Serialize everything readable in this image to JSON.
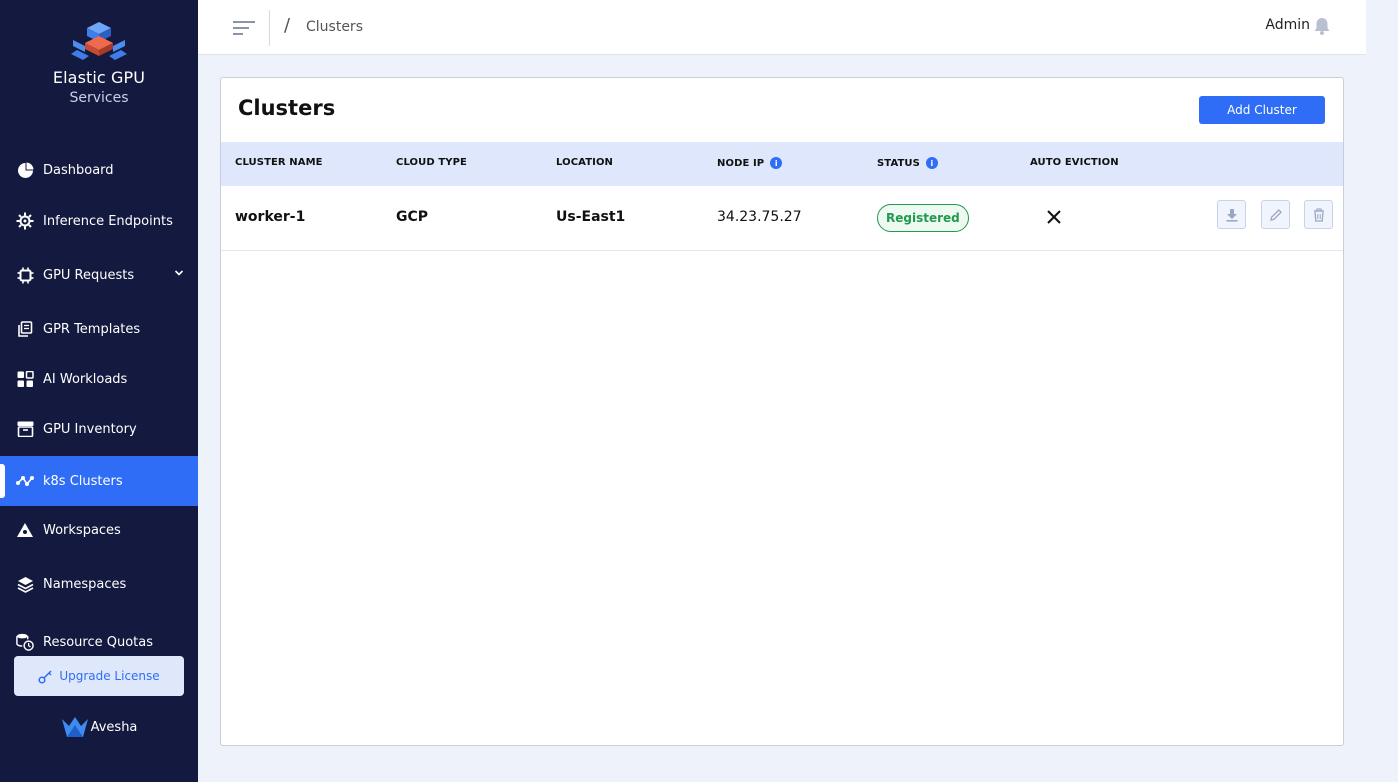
{
  "brand": {
    "title": "Elastic GPU",
    "subtitle": "Services"
  },
  "sidebar": {
    "items": [
      {
        "label": "Dashboard",
        "icon": "pie-chart-icon"
      },
      {
        "label": "Inference Endpoints",
        "icon": "gear-chip-icon"
      },
      {
        "label": "GPU Requests",
        "icon": "chip-icon",
        "expandable": true
      },
      {
        "label": "GPR Templates",
        "icon": "templates-icon"
      },
      {
        "label": "AI Workloads",
        "icon": "widgets-icon"
      },
      {
        "label": "GPU Inventory",
        "icon": "archive-icon"
      },
      {
        "label": "k8s Clusters",
        "icon": "cluster-nodes-icon",
        "active": true
      },
      {
        "label": "Workspaces",
        "icon": "workspace-icon"
      },
      {
        "label": "Namespaces",
        "icon": "layers-icon"
      },
      {
        "label": "Resource Quotas",
        "icon": "quota-clock-icon"
      }
    ],
    "upgrade_label": "Upgrade License",
    "footer_brand": "Avesha"
  },
  "topbar": {
    "breadcrumb_sep": "/",
    "breadcrumb": "Clusters",
    "user": "Admin"
  },
  "page": {
    "title": "Clusters",
    "add_button": "Add Cluster",
    "columns": [
      "CLUSTER NAME",
      "CLOUD TYPE",
      "LOCATION",
      "NODE IP",
      "STATUS",
      "AUTO EVICTION"
    ],
    "info_glyph": "i",
    "rows": [
      {
        "name": "worker-1",
        "cloud": "GCP",
        "location": "Us-East1",
        "node_ip": "34.23.75.27",
        "status": "Registered",
        "auto_eviction": false
      }
    ]
  },
  "colors": {
    "sidebar_bg": "#141a3f",
    "accent": "#2f6df6",
    "status_green": "#1f9a4e"
  }
}
